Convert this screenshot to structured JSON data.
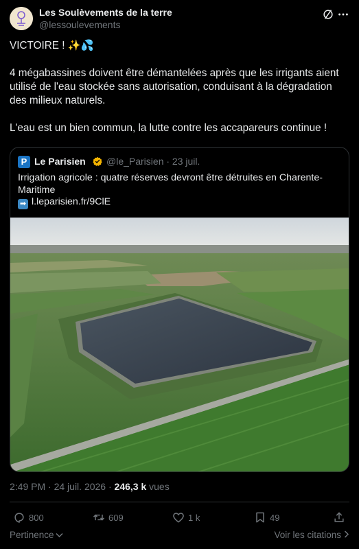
{
  "author": {
    "name": "Les Soulèvements de la terre",
    "handle": "@lessoulevements"
  },
  "tweet": {
    "line1": "VICTOIRE ! ✨💦",
    "paragraph2": "4 mégabassines doivent être démantelées après que les irrigants aient utilisé de l'eau stockée sans autorisation, conduisant à la dégradation des milieux naturels.",
    "paragraph3": "L'eau est un bien commun, la lutte contre les accapareurs continue !"
  },
  "quote": {
    "logo_letter": "P",
    "name": "Le Parisien",
    "handle_date": "@le_Parisien · 23 juil.",
    "text": "Irrigation agricole : quatre réserves devront être détruites en Charente-Maritime",
    "link": "l.leparisien.fr/9ClE",
    "arrow_glyph": "➡"
  },
  "meta": {
    "time_date": "2:49 PM · 24 juil. 2026 · ",
    "views_count": "246,3 k",
    "views_label": " vues"
  },
  "actions": {
    "replies": "800",
    "reposts": "609",
    "likes": "1 k",
    "bookmarks": "49"
  },
  "footer": {
    "pertinence": "Pertinence",
    "citations": "Voir les citations"
  },
  "colors": {
    "accent_verified": "#f4b400",
    "brand_parisien": "#1a74c4",
    "muted_text": "#71767b"
  }
}
